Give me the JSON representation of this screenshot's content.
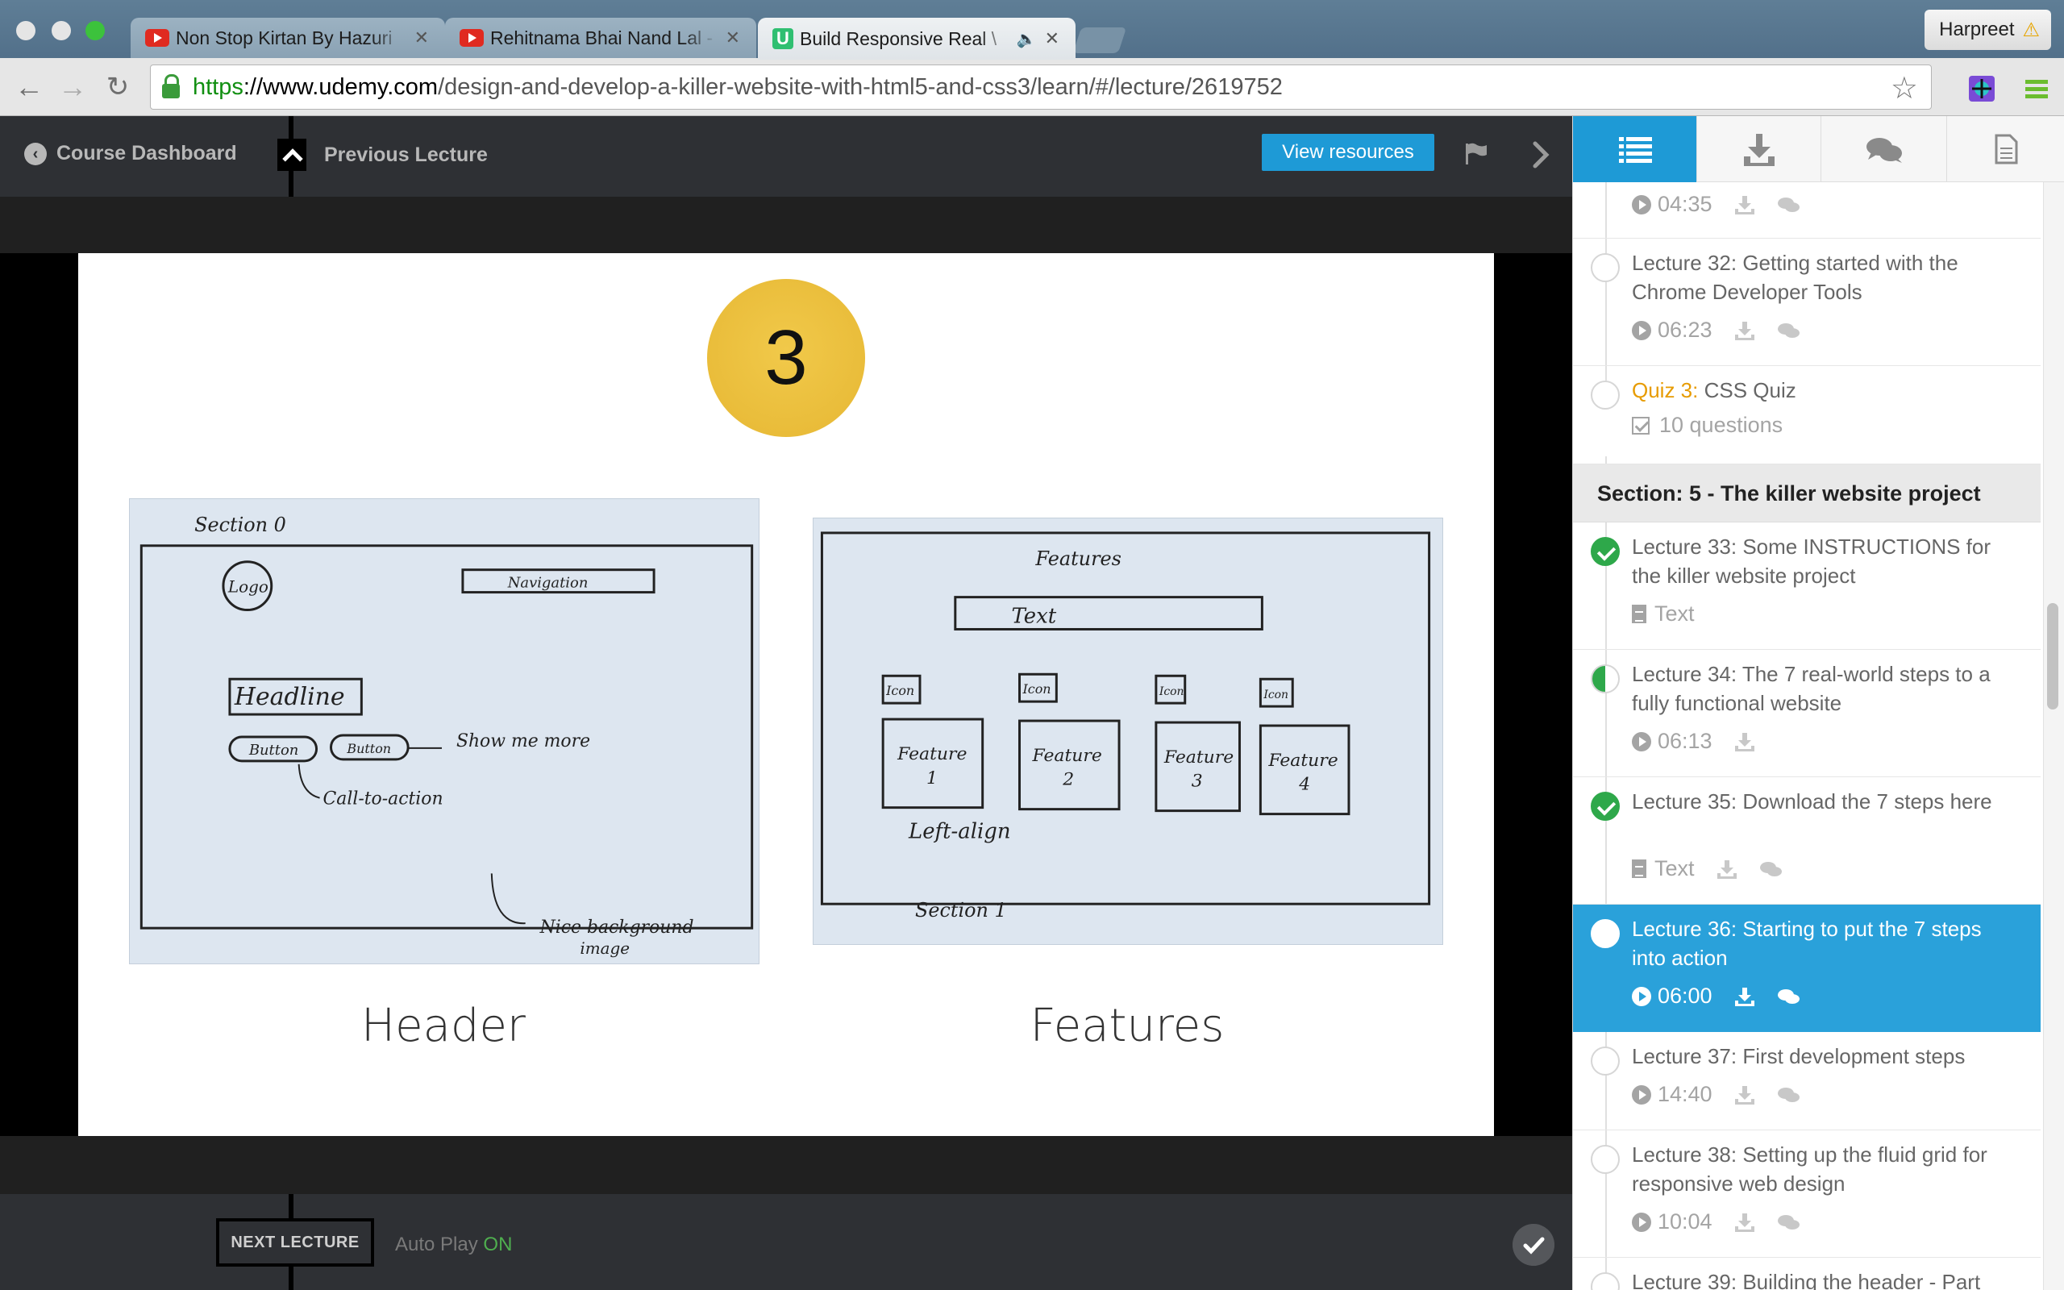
{
  "browser": {
    "tabs": [
      {
        "title": "Non Stop Kirtan By Hazuri",
        "favicon": "youtube-icon"
      },
      {
        "title": "Rehitnama Bhai Nand Lal -",
        "favicon": "youtube-icon"
      },
      {
        "title": "Build Responsive Real \\",
        "favicon": "udemy-icon",
        "favicon_letter": "U",
        "active": true,
        "audio": true
      }
    ],
    "profile_name": "Harpreet",
    "url": {
      "scheme": "https",
      "host": "://www.udemy.com",
      "path": "/design-and-develop-a-killer-website-with-html5-and-css3/learn/#/lecture/2619752"
    }
  },
  "header": {
    "back_label": "Course Dashboard",
    "prev_label": "Previous Lecture",
    "resources_label": "View resources"
  },
  "slide": {
    "badge_number": "3",
    "left_caption": "Header",
    "right_caption": "Features"
  },
  "footer": {
    "next_label": "NEXT LECTURE",
    "autoplay_label": "Auto Play",
    "autoplay_state": "ON"
  },
  "sidebar": {
    "tabs": [
      "list-icon",
      "download-icon",
      "comments-icon",
      "notes-icon"
    ],
    "items": [
      {
        "kind": "lecture",
        "title": "",
        "meta_type": "video",
        "meta": "04:35",
        "state": "none"
      },
      {
        "kind": "lecture",
        "title": "Lecture 32: Getting started with the Chrome Developer Tools",
        "meta_type": "video",
        "meta": "06:23",
        "state": "none"
      },
      {
        "kind": "quiz",
        "quiz_label": "Quiz 3:",
        "title": " CSS Quiz",
        "meta_type": "quiz",
        "meta": "10 questions",
        "state": "none"
      },
      {
        "kind": "section",
        "title": "Section: 5 - The killer website project"
      },
      {
        "kind": "lecture",
        "title": "Lecture 33: Some INSTRUCTIONS for the killer website project",
        "meta_type": "text",
        "meta": "Text",
        "state": "done"
      },
      {
        "kind": "lecture",
        "title": "Lecture 34: The 7 real-world steps to a fully functional website",
        "meta_type": "video",
        "meta": "06:13",
        "state": "half"
      },
      {
        "kind": "lecture",
        "title": "Lecture 35: Download the 7 steps here",
        "meta_type": "text",
        "meta": "Text",
        "state": "done"
      },
      {
        "kind": "lecture",
        "title": "Lecture 36: Starting to put the 7 steps into action",
        "meta_type": "video",
        "meta": "06:00",
        "state": "current"
      },
      {
        "kind": "lecture",
        "title": "Lecture 37: First development steps",
        "meta_type": "video",
        "meta": "14:40",
        "state": "none"
      },
      {
        "kind": "lecture",
        "title": "Lecture 38: Setting up the fluid grid for responsive web design",
        "meta_type": "video",
        "meta": "10:04",
        "state": "none"
      },
      {
        "kind": "lecture",
        "title": "Lecture 39: Building the header - Part",
        "meta_type": "video",
        "meta": "",
        "state": "none"
      }
    ]
  },
  "colors": {
    "accent": "#1e9ad6",
    "complete": "#2ea84a",
    "quiz": "#e79b00",
    "badge": "#e6b733"
  }
}
